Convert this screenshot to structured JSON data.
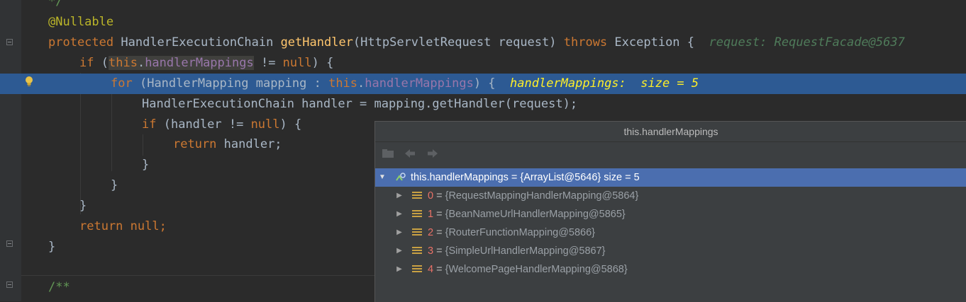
{
  "editor": {
    "lines": {
      "comment_end": "*/",
      "annotation": "@Nullable",
      "sig_protected": "protected",
      "sig_type": "HandlerExecutionChain",
      "sig_method": "getHandler",
      "sig_params": "(HttpServletRequest request)",
      "sig_throws": "throws",
      "sig_exc": "Exception {",
      "sig_hint": "request: RequestFacade@5637",
      "if1_kw": "if",
      "if1_open": "(",
      "if1_this": "this",
      "if1_dot": ".",
      "if1_field": "handlerMappings",
      "if1_ne": " != ",
      "if1_null": "null",
      "if1_close": ") {",
      "for_kw": "for",
      "for_open": "(HandlerMapping mapping : ",
      "for_this": "this",
      "for_dot": ".",
      "for_field": "handlerMappings",
      "for_close": ") {",
      "for_hint": "handlerMappings:  size = 5",
      "handler_line": "HandlerExecutionChain handler = mapping.getHandler(request);",
      "if2_kw": "if",
      "if2_open": "(handler != ",
      "if2_null": "null",
      "if2_close": ") {",
      "ret1_kw": "return",
      "ret1_rest": " handler;",
      "brace1": "}",
      "brace2": "}",
      "brace3": "}",
      "ret2_kw": "return",
      "ret2_null": "null",
      "ret2_semi": ";",
      "brace4": "}",
      "javadoc": "/**"
    }
  },
  "popup": {
    "title": "this.handlerMappings",
    "root": {
      "label": "this.handlerMappings = {ArrayList@5646}  size = 5"
    },
    "items": [
      {
        "index": "0",
        "eq": " = ",
        "value": "{RequestMappingHandlerMapping@5864}"
      },
      {
        "index": "1",
        "eq": " = ",
        "value": "{BeanNameUrlHandlerMapping@5865}"
      },
      {
        "index": "2",
        "eq": " = ",
        "value": "{RouterFunctionMapping@5866}"
      },
      {
        "index": "3",
        "eq": " = ",
        "value": "{SimpleUrlHandlerMapping@5867}"
      },
      {
        "index": "4",
        "eq": " = ",
        "value": "{WelcomePageHandlerMapping@5868}"
      }
    ],
    "toolbar": {
      "icons": [
        "folder-icon",
        "back-arrow-icon",
        "forward-arrow-icon"
      ]
    }
  },
  "colors": {
    "editor_bg": "#2b2b2b",
    "current_line": "#2d5a93",
    "popup_bg": "#3c3f41",
    "selection": "#4b6eaf",
    "keyword": "#cc7832",
    "method": "#ffc66d",
    "field": "#9876aa",
    "inline_hint": "#ffef28"
  }
}
